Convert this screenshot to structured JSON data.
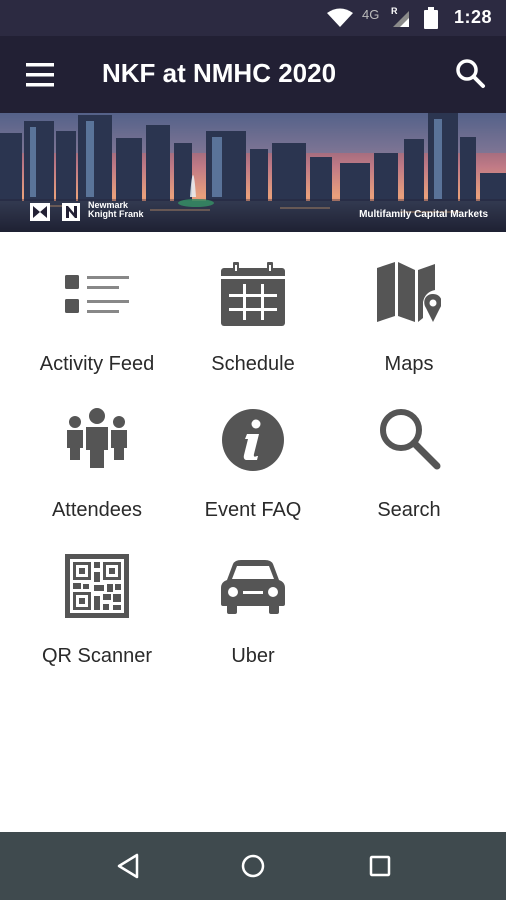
{
  "status_bar": {
    "network_label": "4G",
    "roaming_label": "R",
    "time": "1:28"
  },
  "app_bar": {
    "title": "NKF at NMHC 2020"
  },
  "banner": {
    "brand_lines": "Newmark\nKnight Frank",
    "tagline": "Multifamily Capital Markets"
  },
  "menu_grid": {
    "items": [
      {
        "label": "Activity Feed",
        "icon": "activity-feed-icon"
      },
      {
        "label": "Schedule",
        "icon": "calendar-icon"
      },
      {
        "label": "Maps",
        "icon": "map-icon"
      },
      {
        "label": "Attendees",
        "icon": "people-icon"
      },
      {
        "label": "Event FAQ",
        "icon": "info-icon"
      },
      {
        "label": "Search",
        "icon": "search-icon"
      },
      {
        "label": "QR Scanner",
        "icon": "qr-code-icon"
      },
      {
        "label": "Uber",
        "icon": "car-icon"
      }
    ]
  },
  "nav_bar": {
    "buttons": [
      "back-icon",
      "home-icon",
      "recents-icon"
    ]
  },
  "colors": {
    "status_bar": "#2c2a41",
    "app_bar": "#222034",
    "icon_gray": "#555555",
    "nav_bar": "#3f4a4e"
  }
}
